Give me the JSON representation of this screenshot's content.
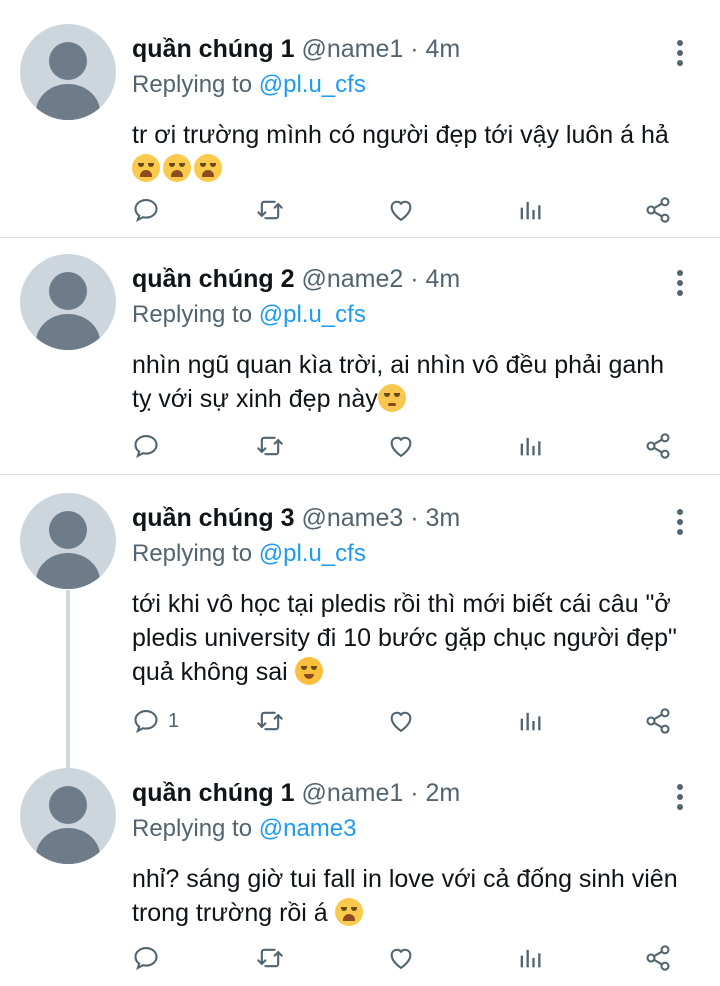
{
  "tweets": [
    {
      "name": "quần chúng 1",
      "handle": "@name1",
      "dot": "·",
      "time": "4m",
      "replying_prefix": "Replying to ",
      "replying_to": "@pl.u_cfs",
      "lines": [
        "tr ơi trường mình có người đẹp tới vậy luôn á hả"
      ],
      "emoji_line": [
        "loudly-crying-face",
        "loudly-crying-face",
        "loudly-crying-face"
      ],
      "reply_count": ""
    },
    {
      "name": "quần chúng 2",
      "handle": "@name2",
      "dot": "·",
      "time": "4m",
      "replying_prefix": "Replying to ",
      "replying_to": "@pl.u_cfs",
      "lines": [
        "nhìn ngũ quan kìa trời, ai nhìn vô đều phải ganh",
        "tỵ với sự xinh đẹp này"
      ],
      "emoji_after_last": "pleading-face",
      "reply_count": ""
    },
    {
      "name": "quần chúng 3",
      "handle": "@name3",
      "dot": "·",
      "time": "3m",
      "replying_prefix": "Replying to ",
      "replying_to": "@pl.u_cfs",
      "lines": [
        "tới khi vô học tại pledis rồi thì mới biết cái câu \"ở",
        "pledis university đi 10 bước gặp chục người đẹp\"",
        "quả không sai "
      ],
      "emoji_after_last": "smiling-face-with-hearts",
      "reply_count": "1"
    },
    {
      "name": "quần chúng 1",
      "handle": "@name1",
      "dot": "·",
      "time": "2m",
      "replying_prefix": "Replying to ",
      "replying_to": "@name3",
      "lines": [
        "nhỉ? sáng giờ tui fall in love với cả đống sinh viên",
        "trong trường rồi á "
      ],
      "emoji_after_last": "loudly-crying-face",
      "reply_count": ""
    }
  ],
  "icons": {
    "reply": "reply-icon",
    "retweet": "retweet-icon",
    "like": "heart-icon",
    "views": "views-icon",
    "share": "share-icon",
    "menu": "more-vertical-icon"
  },
  "colors": {
    "text": "#0f1419",
    "secondary": "#536471",
    "mention": "#1d9bf0",
    "divider": "#dfe3e6"
  }
}
